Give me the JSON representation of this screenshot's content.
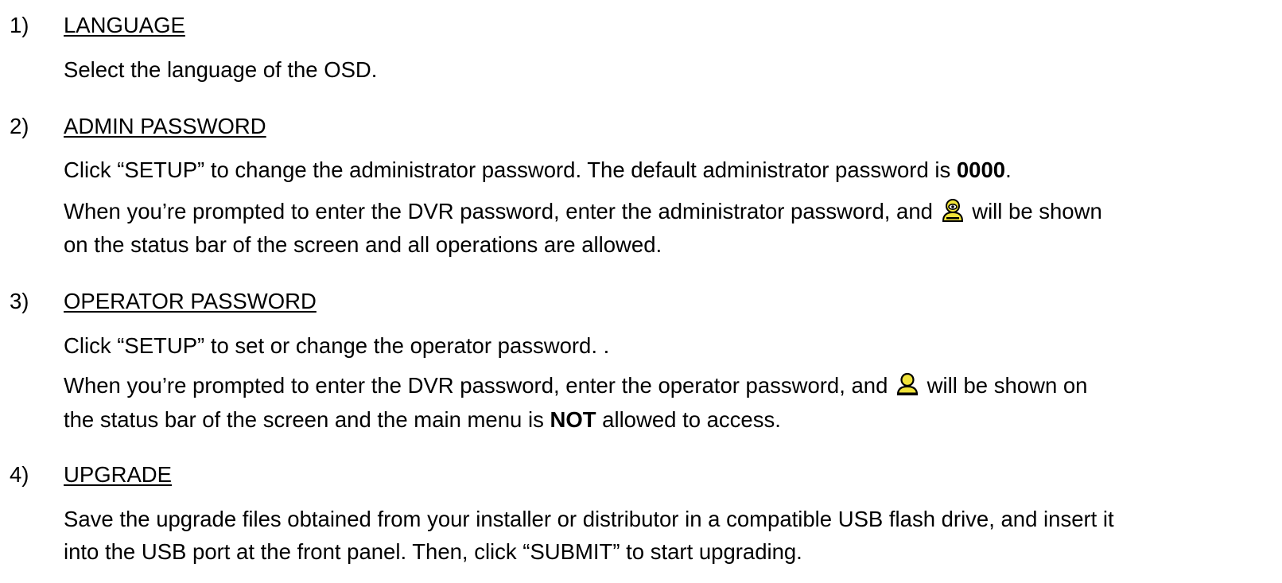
{
  "sections": [
    {
      "number": "1)",
      "heading": "LANGUAGE",
      "p1": "Select the language of the OSD."
    },
    {
      "number": "2)",
      "heading": "ADMIN PASSWORD",
      "p1_a": "Click “SETUP” to change the administrator password. The default administrator password is ",
      "p1_bold": "0000",
      "p1_b": ".",
      "p2_a": "When you’re prompted to enter the DVR password, enter the administrator password, and ",
      "p2_b": " will be shown",
      "p3": "on the status bar of the screen and all operations are allowed.",
      "icon": "admin-user-icon"
    },
    {
      "number": "3)",
      "heading": "OPERATOR PASSWORD",
      "p1": "Click “SETUP” to set or change the operator password. .",
      "p2_a": "When you’re prompted to enter the DVR password, enter the operator password, and ",
      "p2_b": " will be shown on",
      "p3_a": "the status bar of the screen and the main menu is ",
      "p3_bold": "NOT",
      "p3_b": " allowed to access.",
      "icon": "operator-user-icon"
    },
    {
      "number": "4)",
      "heading": "UPGRADE",
      "p1": "Save the upgrade files obtained from your installer or distributor in a compatible USB flash drive, and insert it",
      "p2": "into the USB port at the front panel. Then, click “SUBMIT” to start upgrading."
    }
  ],
  "colors": {
    "icon_fill": "#f0e33a",
    "icon_stroke": "#000000"
  }
}
